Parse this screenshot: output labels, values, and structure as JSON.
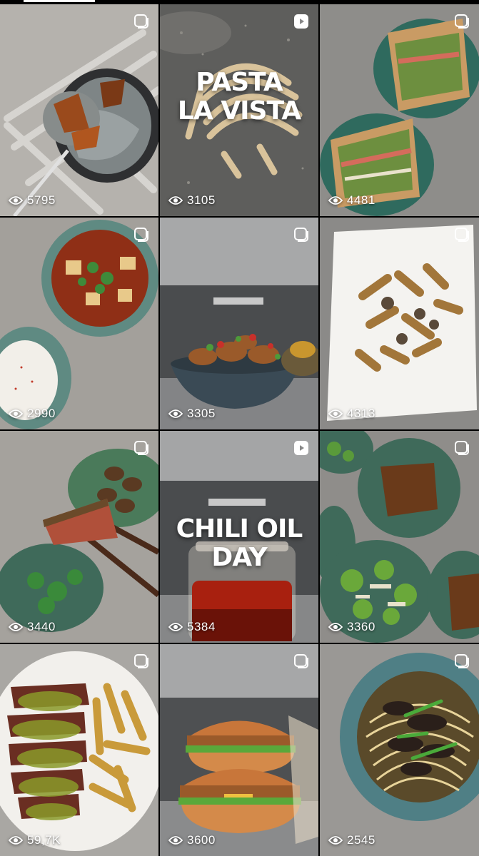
{
  "grid": {
    "posts": [
      {
        "views": "5795",
        "type": "carousel"
      },
      {
        "views": "3105",
        "type": "reel",
        "overlay": "PASTA\nLA VISTA"
      },
      {
        "views": "4481",
        "type": "carousel"
      },
      {
        "views": "2990",
        "type": "carousel"
      },
      {
        "views": "3305",
        "type": "carousel"
      },
      {
        "views": "4313",
        "type": "carousel"
      },
      {
        "views": "3440",
        "type": "carousel"
      },
      {
        "views": "5384",
        "type": "reel",
        "overlay": "CHILI OIL\nDAY"
      },
      {
        "views": "3360",
        "type": "carousel"
      },
      {
        "views": "59,7K",
        "type": "carousel"
      },
      {
        "views": "3600",
        "type": "carousel"
      },
      {
        "views": "2545",
        "type": "carousel"
      }
    ]
  },
  "icons": {
    "views": "eye-icon",
    "carousel": "carousel-icon",
    "reel": "reel-icon"
  },
  "colors": {
    "text": "#ffffff",
    "background": "#000000"
  }
}
